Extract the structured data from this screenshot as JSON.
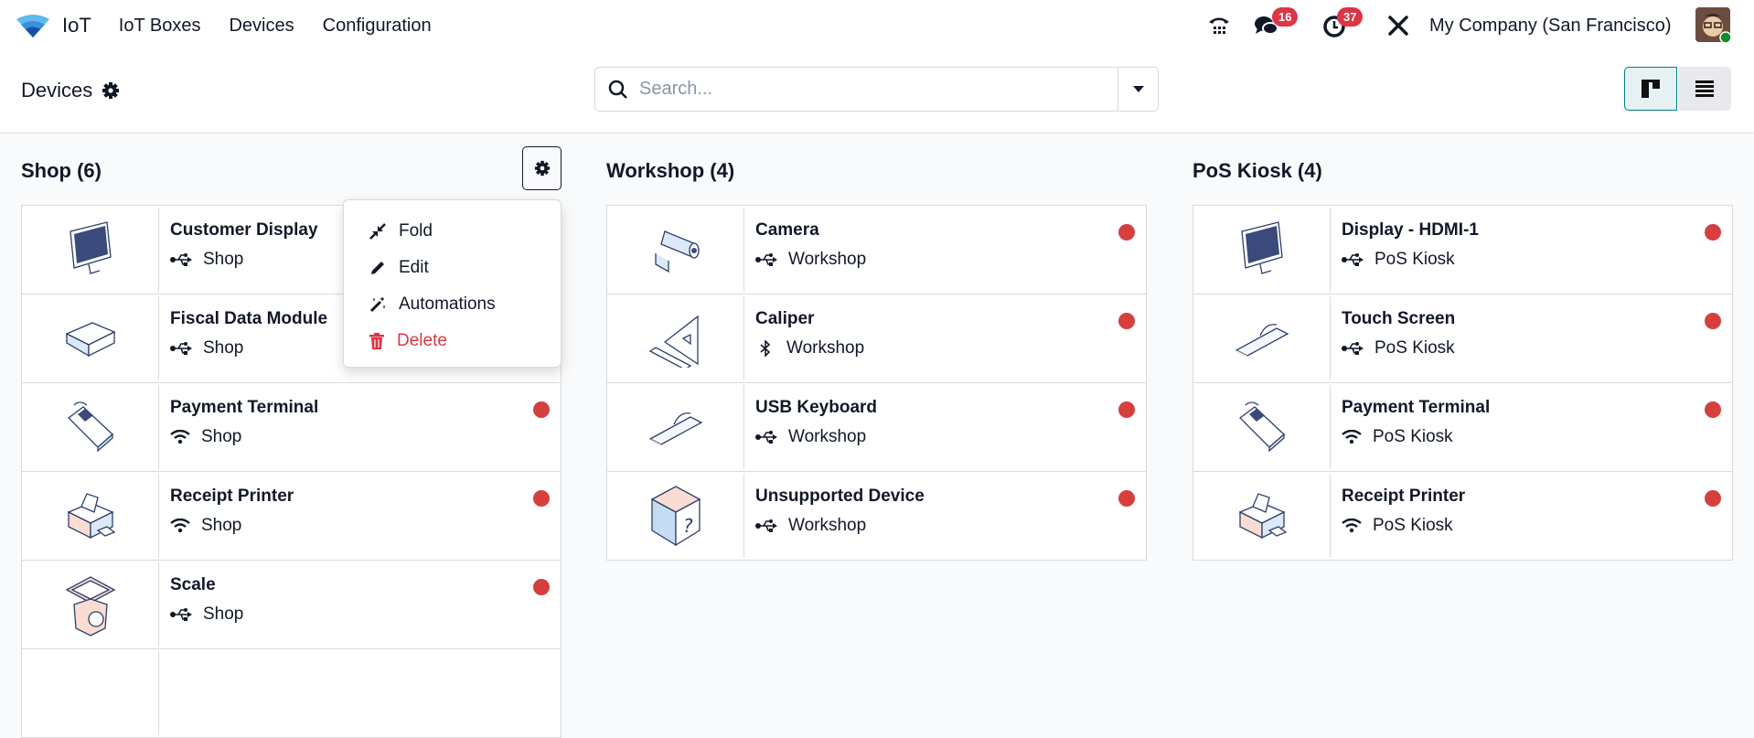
{
  "nav": {
    "app_name": "IoT",
    "menus": [
      "IoT Boxes",
      "Devices",
      "Configuration"
    ],
    "messages_count": "16",
    "activities_count": "37",
    "company": "My Company (San Francisco)"
  },
  "control": {
    "title": "Devices",
    "search_placeholder": "Search...",
    "search_value": ""
  },
  "colors": {
    "status_dot": "#d5403f",
    "badge": "#dc3545",
    "delete": "#dc3545",
    "accent": "#017e84"
  },
  "columns": [
    {
      "title": "Shop (6)",
      "devices": [
        {
          "name": "Customer Display",
          "location": "Shop",
          "connection": "usb",
          "icon": "monitor"
        },
        {
          "name": "Fiscal Data Module",
          "location": "Shop",
          "connection": "usb",
          "icon": "box"
        },
        {
          "name": "Payment Terminal",
          "location": "Shop",
          "connection": "wifi",
          "icon": "terminal"
        },
        {
          "name": "Receipt Printer",
          "location": "Shop",
          "connection": "wifi",
          "icon": "printer"
        },
        {
          "name": "Scale",
          "location": "Shop",
          "connection": "usb",
          "icon": "scale"
        }
      ]
    },
    {
      "title": "Workshop (4)",
      "devices": [
        {
          "name": "Camera",
          "location": "Workshop",
          "connection": "usb",
          "icon": "camera"
        },
        {
          "name": "Caliper",
          "location": "Workshop",
          "connection": "bluetooth",
          "icon": "caliper"
        },
        {
          "name": "USB Keyboard",
          "location": "Workshop",
          "connection": "usb",
          "icon": "keyboard"
        },
        {
          "name": "Unsupported Device",
          "location": "Workshop",
          "connection": "usb",
          "icon": "unknown"
        }
      ]
    },
    {
      "title": "PoS Kiosk (4)",
      "devices": [
        {
          "name": "Display - HDMI-1",
          "location": "PoS Kiosk",
          "connection": "usb",
          "icon": "monitor"
        },
        {
          "name": "Touch Screen",
          "location": "PoS Kiosk",
          "connection": "usb",
          "icon": "keyboard"
        },
        {
          "name": "Payment Terminal",
          "location": "PoS Kiosk",
          "connection": "wifi",
          "icon": "terminal"
        },
        {
          "name": "Receipt Printer",
          "location": "PoS Kiosk",
          "connection": "wifi",
          "icon": "printer"
        }
      ]
    }
  ],
  "dropdown": {
    "fold": "Fold",
    "edit": "Edit",
    "automations": "Automations",
    "delete": "Delete"
  }
}
